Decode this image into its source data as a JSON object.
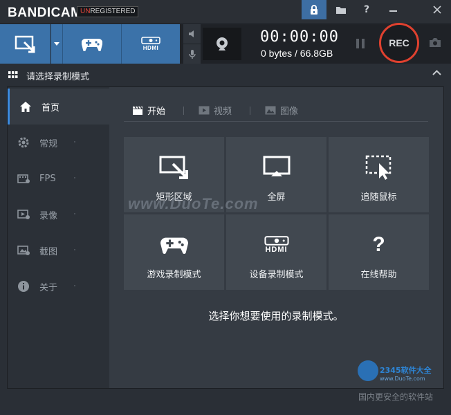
{
  "app": {
    "name": "BANDICAM",
    "badge_highlight": "UN",
    "badge_rest": "REGISTERED"
  },
  "titlebar": {
    "lock_icon": "lock-icon",
    "folder_icon": "folder-icon",
    "help_icon": "help-icon",
    "minimize_icon": "minimize-icon",
    "close_icon": "close-icon"
  },
  "toolbar": {
    "timer": "00:00:00",
    "size": "0 bytes / 66.8GB",
    "rec_label": "REC",
    "hdmi_label": "HDMI"
  },
  "modebar": {
    "label": "请选择录制模式"
  },
  "sidebar": {
    "items": [
      {
        "label": "首页",
        "icon": "home-icon"
      },
      {
        "label": "常规",
        "icon": "gear-icon"
      },
      {
        "label": "FPS",
        "icon": "fps-icon"
      },
      {
        "label": "录像",
        "icon": "video-settings-icon"
      },
      {
        "label": "截图",
        "icon": "image-settings-icon"
      },
      {
        "label": "关于",
        "icon": "info-icon"
      }
    ]
  },
  "tabs": [
    {
      "label": "开始",
      "icon": "clapper-icon"
    },
    {
      "label": "视频",
      "icon": "play-icon"
    },
    {
      "label": "图像",
      "icon": "image-icon"
    }
  ],
  "tiles": [
    {
      "label": "矩形区域",
      "icon": "rectangle-area-icon"
    },
    {
      "label": "全屏",
      "icon": "fullscreen-monitor-icon"
    },
    {
      "label": "追随鼠标",
      "icon": "follow-mouse-icon"
    },
    {
      "label": "游戏录制模式",
      "icon": "gamepad-icon"
    },
    {
      "label": "设备录制模式",
      "icon": "hdmi-device-icon"
    },
    {
      "label": "在线帮助",
      "icon": "question-icon"
    }
  ],
  "hint": "选择你想要使用的录制模式。",
  "watermarks": {
    "duote": "www.DuoTe.com",
    "brand_name": "2345软件大全",
    "brand_url": "www.DuoTe.com",
    "bottom": "国内更安全的软件站"
  },
  "colors": {
    "accent_blue": "#3b72a9",
    "rec_red": "#e0412f",
    "active_indicator": "#3b8be0"
  }
}
